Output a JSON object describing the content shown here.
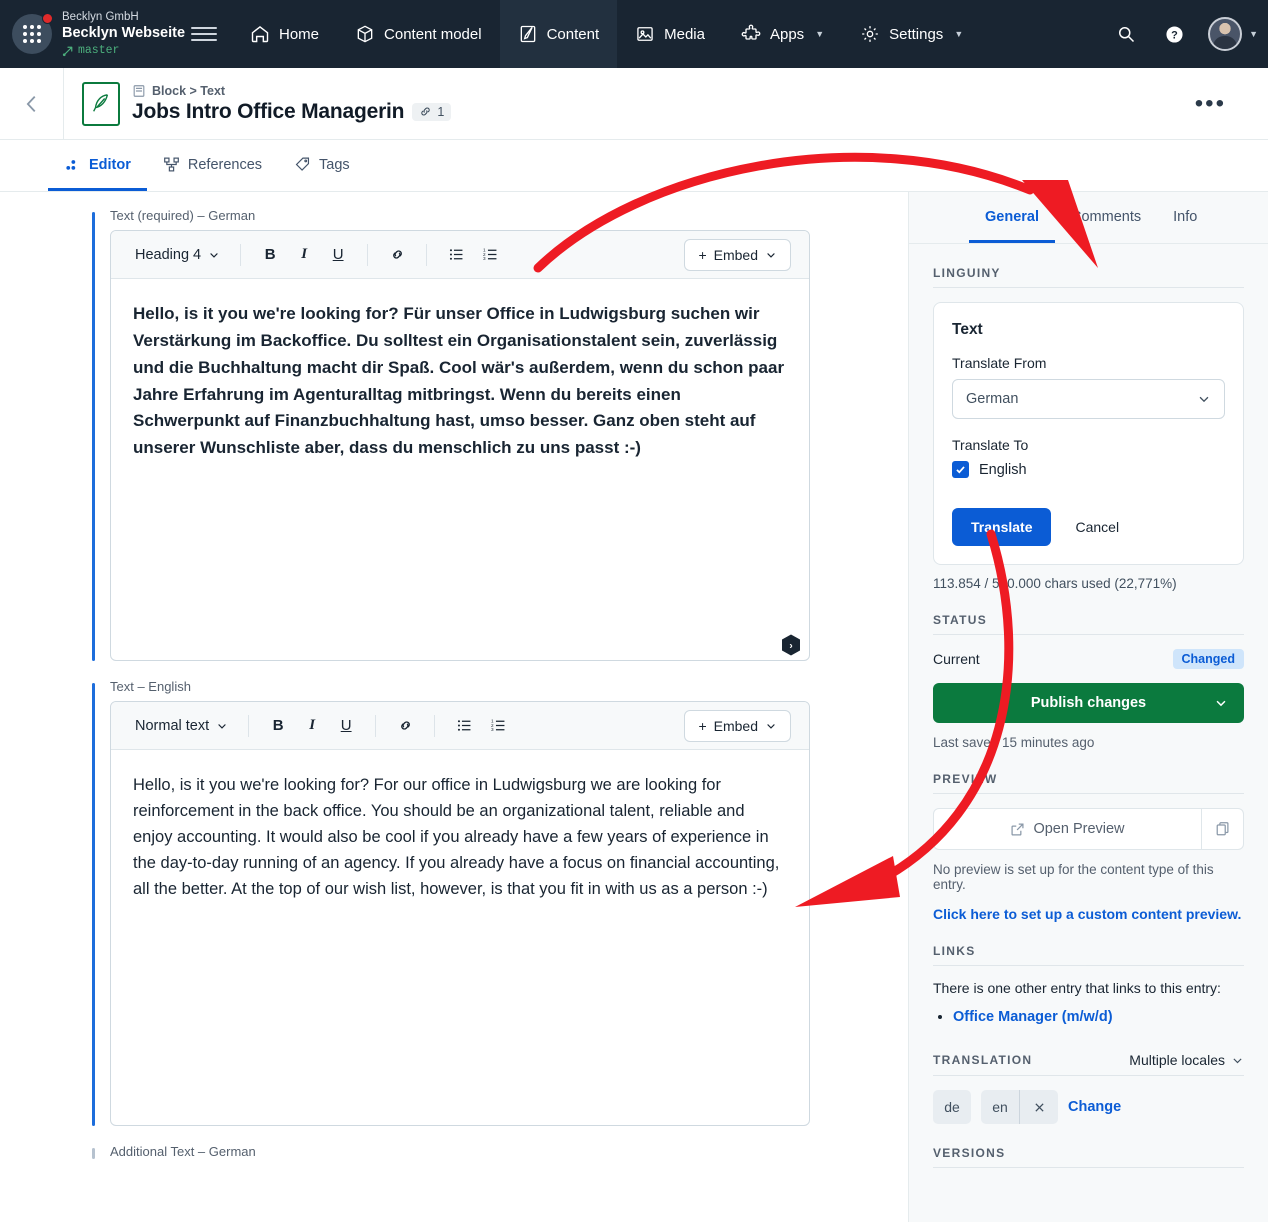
{
  "topnav": {
    "org_name": "Becklyn GmbH",
    "space_name": "Becklyn Webseite",
    "branch": "master",
    "items": [
      {
        "label": "Home",
        "icon": "home-icon",
        "active": false
      },
      {
        "label": "Content model",
        "icon": "content-model-icon",
        "active": false
      },
      {
        "label": "Content",
        "icon": "content-icon",
        "active": true
      },
      {
        "label": "Media",
        "icon": "media-icon",
        "active": false
      },
      {
        "label": "Apps",
        "icon": "apps-icon",
        "active": false,
        "caret": true
      },
      {
        "label": "Settings",
        "icon": "gear-icon",
        "active": false,
        "caret": true
      }
    ],
    "search_icon": "search-icon",
    "help_icon": "help-icon",
    "avatar": "user-avatar"
  },
  "entry_header": {
    "breadcrumb": "Block > Text",
    "title": "Jobs Intro Office Managerin",
    "link_count": "1",
    "more_label": "•••"
  },
  "tabs": [
    {
      "label": "Editor",
      "icon": "editor-icon",
      "active": true
    },
    {
      "label": "References",
      "icon": "references-icon",
      "active": false
    },
    {
      "label": "Tags",
      "icon": "tag-icon",
      "active": false
    }
  ],
  "fields": [
    {
      "label": "Text (required) – German",
      "style": "Heading 4",
      "embed_label": "Embed",
      "content": "Hello, is it you we're looking for? Für unser Office in Ludwigsburg suchen wir Verstärkung im Backoffice. Du solltest ein Organisationstalent sein, zuverlässig und die Buchhaltung macht dir Spaß. Cool wär's außerdem, wenn du schon paar Jahre Erfahrung im Agenturalltag mitbringst. Wenn du bereits einen Schwerpunkt auf Finanzbuchhaltung hast, umso besser. Ganz oben steht auf unserer Wunschliste aber, dass du menschlich zu uns passt :-)"
    },
    {
      "label": "Text – English",
      "style": "Normal text",
      "embed_label": "Embed",
      "content": "Hello, is it you we're looking for? For our office in Ludwigsburg we are looking for reinforcement in the back office. You should be an organizational talent, reliable and enjoy accounting. It would also be cool if you already have a few years of experience in the day-to-day running of an agency. If you already have a focus on financial accounting, all the better. At the top of our wish list, however, is that you fit in with us as a person :-)"
    },
    {
      "label": "Additional Text – German"
    }
  ],
  "toolbar_buttons": [
    {
      "name": "bold-button",
      "glyph": "B"
    },
    {
      "name": "italic-button",
      "glyph": "I"
    },
    {
      "name": "underline-button",
      "glyph": "U"
    },
    {
      "name": "link-button",
      "glyph": "link-icon"
    },
    {
      "name": "bulleted-list-button",
      "glyph": "bulleted-list-icon"
    },
    {
      "name": "numbered-list-button",
      "glyph": "numbered-list-icon"
    }
  ],
  "sidebar": {
    "tabs": [
      {
        "label": "General",
        "active": true
      },
      {
        "label": "Comments",
        "active": false
      },
      {
        "label": "Info",
        "active": false
      }
    ],
    "linguiny": {
      "heading": "LINGUINY",
      "card_title": "Text",
      "translate_from_label": "Translate From",
      "translate_from_value": "German",
      "translate_to_label": "Translate To",
      "translate_to_value": "English",
      "translate_button": "Translate",
      "cancel_button": "Cancel",
      "quota": "113.854 / 500.000 chars used (22,771%)"
    },
    "status": {
      "heading": "STATUS",
      "current_label": "Current",
      "badge": "Changed",
      "publish_label": "Publish changes",
      "last_saved": "Last saved 15 minutes ago"
    },
    "preview": {
      "heading": "PREVIEW",
      "open_label": "Open Preview",
      "note": "No preview is set up for the content type of this entry.",
      "setup_link": "Click here to set up a custom content preview."
    },
    "links": {
      "heading": "LINKS",
      "intro": "There is one other entry that links to this entry:",
      "items": [
        "Office Manager (m/w/d)"
      ]
    },
    "translation": {
      "heading": "TRANSLATION",
      "selector": "Multiple locales",
      "locales": [
        "de",
        "en"
      ],
      "change_label": "Change"
    },
    "versions": {
      "heading": "VERSIONS"
    }
  },
  "annotations": {
    "arrow_color": "#ee1b23",
    "arrow_1": "from editor toolbar to Linguiny Text card",
    "arrow_2": "from Translate button to English translated text"
  },
  "colors": {
    "nav_bg": "#192532",
    "accent_blue": "#0b5cd5",
    "publish_green": "#0b7a3e",
    "arrow_red": "#ee1b23"
  }
}
